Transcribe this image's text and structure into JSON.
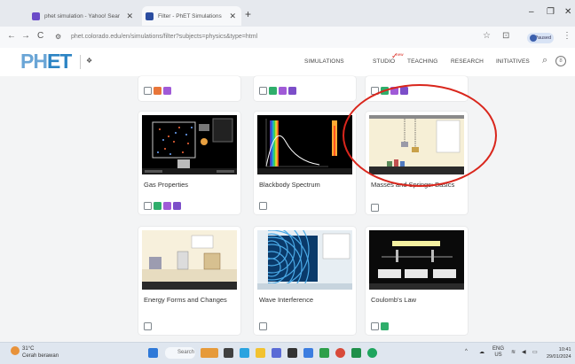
{
  "browser": {
    "tabs": [
      {
        "title": "phet simulation - Yahoo! Sear",
        "favicon_color": "#6b4bc8"
      },
      {
        "title": "Filter - PhET Simulations",
        "favicon_color": "#2b4da0"
      }
    ],
    "new_tab": "+",
    "window_controls": [
      "‒",
      "❐",
      "✕"
    ],
    "nav": [
      "←",
      "→",
      "C"
    ],
    "url": "phet.colorado.edu/en/simulations/filter?subjects=physics&type=html",
    "address_icons": [
      "☆",
      "⊡"
    ],
    "profile_label": "Paused"
  },
  "site": {
    "logo_ph": "PH",
    "logo_et": "ET",
    "nav": [
      "SIMULATIONS",
      "STUDIO",
      "TEACHING",
      "RESEARCH",
      "INITIATIVES"
    ],
    "studio_badge": "new",
    "search_icon": "⌕",
    "user_icon": "8"
  },
  "badge_colors": {
    "gray": "#7e868c",
    "green": "#2fae6b",
    "purple": "#a05ad7",
    "purple2": "#7c4ec9"
  },
  "cards": [
    {
      "title": "Gas Properties",
      "badges": [
        "gray",
        "green",
        "purple",
        "purple2"
      ]
    },
    {
      "title": "Blackbody Spectrum",
      "badges": [
        "gray"
      ]
    },
    {
      "title": "Masses and Springs: Basics",
      "badges": [
        "gray"
      ]
    },
    {
      "title": "Energy Forms and Changes",
      "badges": [
        "gray"
      ]
    },
    {
      "title": "Wave Interference",
      "badges": [
        "gray"
      ]
    },
    {
      "title": "Coulomb's Law",
      "badges": [
        "gray",
        "green"
      ]
    }
  ],
  "top_row_badges": [
    [
      "gray",
      "orange",
      "purple"
    ],
    [
      "gray",
      "green",
      "purple",
      "purple2"
    ],
    [
      "gray",
      "green",
      "purple",
      "purple2"
    ]
  ],
  "taskbar": {
    "weather_temp": "31°C",
    "weather_desc": "Cerah berawan",
    "search_label": "Search",
    "language": "ENG",
    "region": "US",
    "time": "10:41",
    "date": "29/01/2024"
  },
  "annotation": {
    "mark": "✓",
    "color": "#d9261c"
  }
}
